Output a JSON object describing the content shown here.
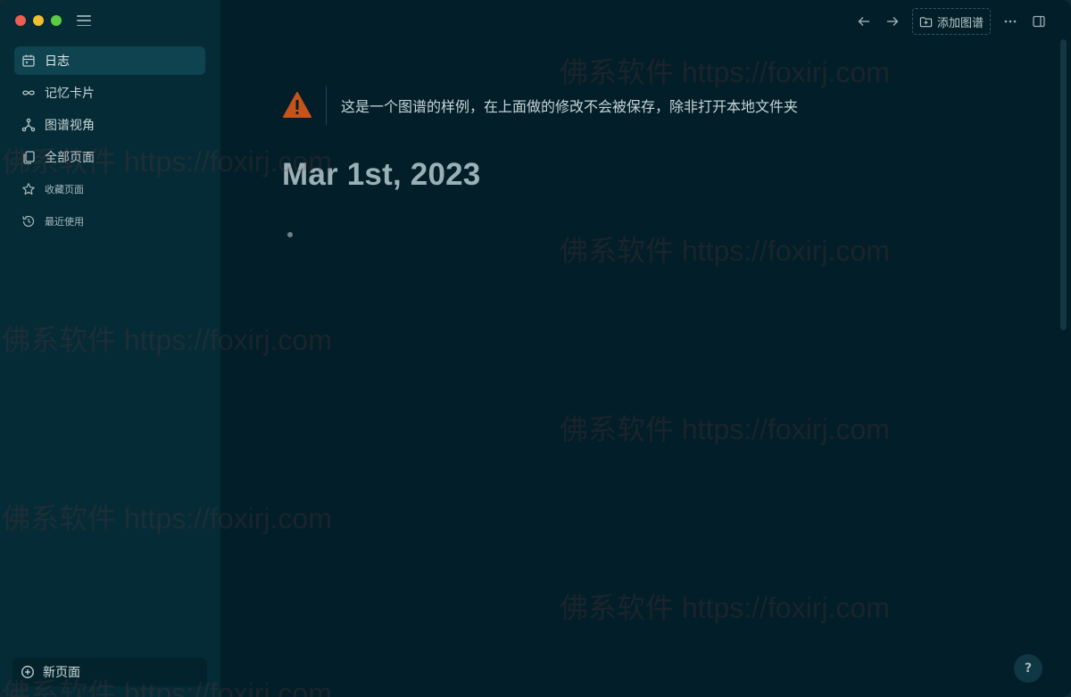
{
  "sidebar": {
    "items": [
      {
        "label": "日志",
        "icon": "calendar-icon"
      },
      {
        "label": "记忆卡片",
        "icon": "infinity-icon"
      },
      {
        "label": "图谱视角",
        "icon": "graph-icon"
      },
      {
        "label": "全部页面",
        "icon": "pages-icon"
      },
      {
        "label": "收藏页面",
        "icon": "star-icon"
      },
      {
        "label": "最近使用",
        "icon": "history-icon"
      }
    ],
    "new_page_label": "新页面"
  },
  "toolbar": {
    "add_graph_label": "添加图谱"
  },
  "main": {
    "warning_text": "这是一个图谱的样例，在上面做的修改不会被保存，除非打开本地文件夹",
    "page_title": "Mar 1st, 2023"
  },
  "help_label": "?",
  "watermark": "佛系软件 https://foxirj.com",
  "colors": {
    "warning": "#c6531b",
    "active_nav": "#0f4350"
  }
}
